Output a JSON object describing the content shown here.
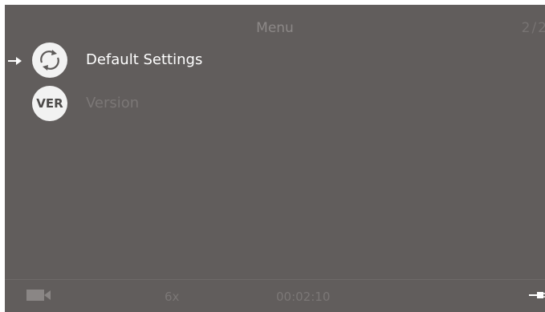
{
  "header": {
    "title": "Menu",
    "page_indicator": "2/2"
  },
  "menu": {
    "items": [
      {
        "label": "Default Settings",
        "icon": "reset-icon",
        "selected": true
      },
      {
        "label": "Version",
        "icon": "version-icon",
        "icon_text": "VER",
        "selected": false
      }
    ]
  },
  "status_bar": {
    "record_icon": "camera-icon",
    "zoom": "6x",
    "timer": "00:02:10",
    "power_icon": "plug-icon"
  },
  "colors": {
    "background": "#615d5c",
    "selected_text": "#ffffff",
    "dim_text": "#7b7776",
    "icon_fill": "#f2f2f2"
  }
}
